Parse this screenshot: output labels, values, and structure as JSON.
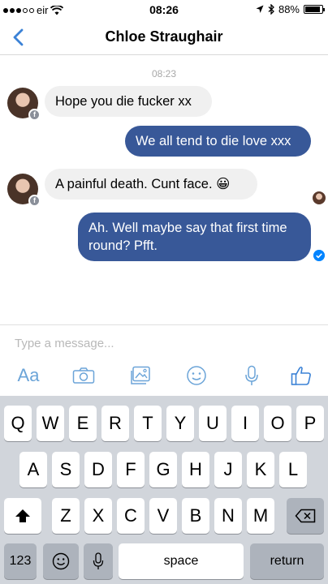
{
  "status_bar": {
    "carrier": "eir",
    "time": "08:26",
    "battery": "88%",
    "battery_level": 0.88
  },
  "nav": {
    "title": "Chloe Straughair"
  },
  "conversation": {
    "timestamp": "08:23",
    "messages": [
      {
        "direction": "in",
        "text": "Hope you die fucker xx"
      },
      {
        "direction": "out",
        "text": "We all tend to die love xxx"
      },
      {
        "direction": "in",
        "text": "A painful death. Cunt face. 😀"
      },
      {
        "direction": "out",
        "text": "Ah. Well maybe say that first time round? Pfft."
      }
    ]
  },
  "composer": {
    "placeholder": "Type a message...",
    "tools": [
      "text-style-icon",
      "camera-icon",
      "gallery-icon",
      "emoji-icon",
      "microphone-icon",
      "like-icon"
    ],
    "aa_label": "Aa"
  },
  "keyboard": {
    "row1": [
      "Q",
      "W",
      "E",
      "R",
      "T",
      "Y",
      "U",
      "I",
      "O",
      "P"
    ],
    "row2": [
      "A",
      "S",
      "D",
      "F",
      "G",
      "H",
      "J",
      "K",
      "L"
    ],
    "row3": [
      "Z",
      "X",
      "C",
      "V",
      "B",
      "N",
      "M"
    ],
    "numbers_label": "123",
    "space_label": "space",
    "return_label": "return"
  },
  "colors": {
    "accent": "#385898",
    "link": "#3b82d6",
    "icon": "#6ba4d8",
    "keyboard_bg": "#d1d5db"
  }
}
